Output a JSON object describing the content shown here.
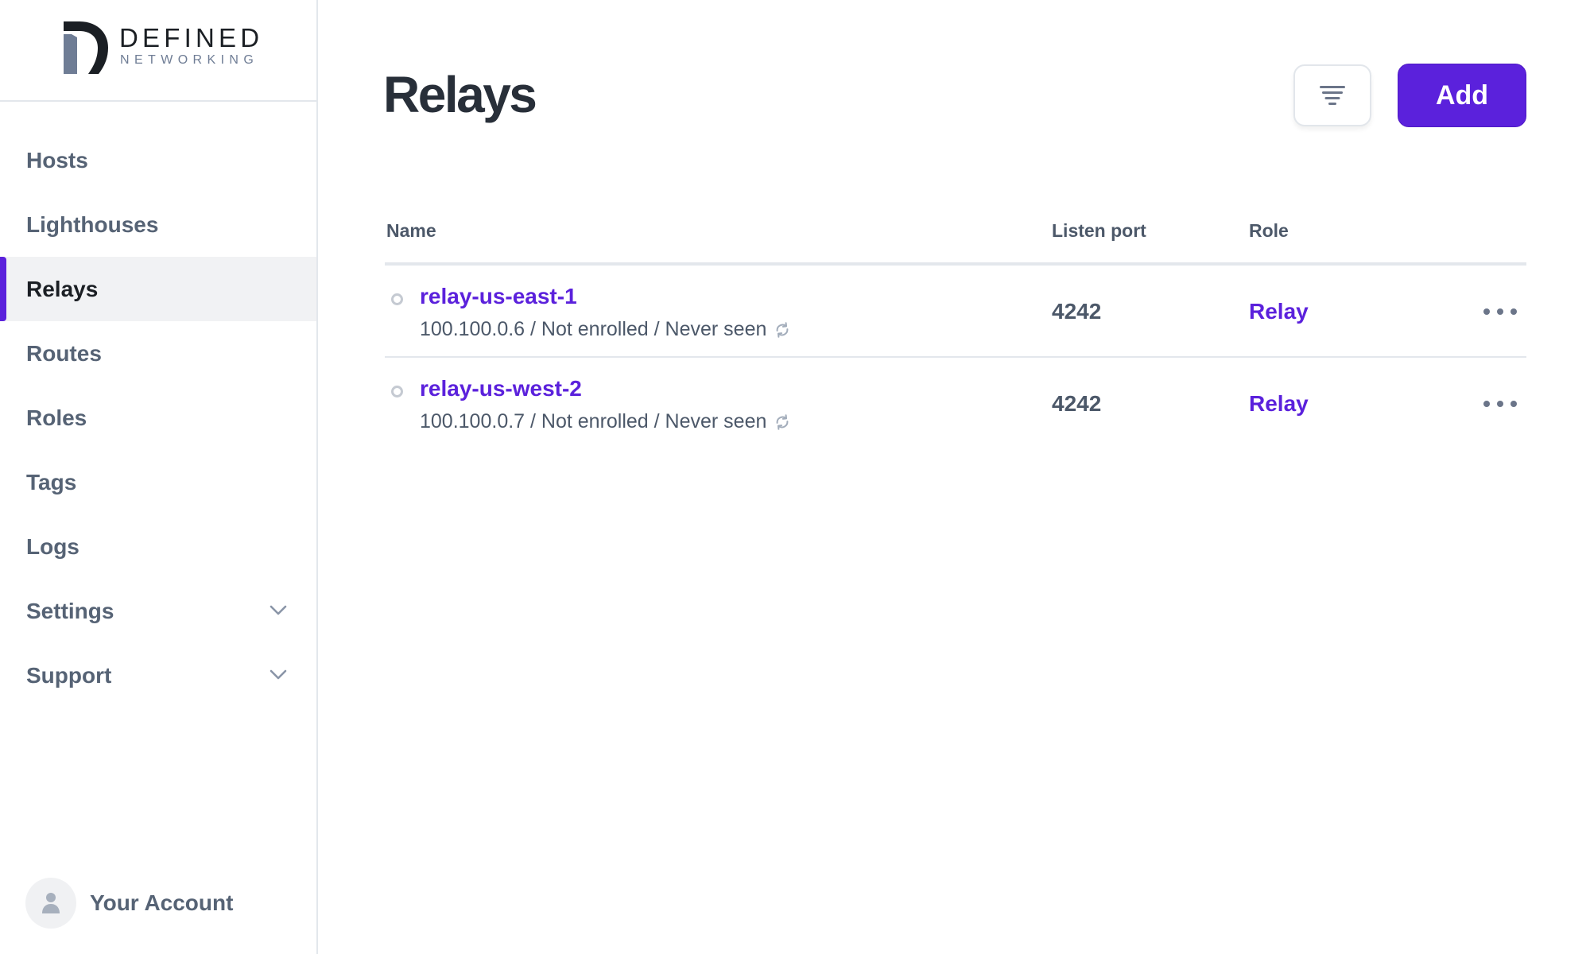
{
  "brand": {
    "name": "DEFINED",
    "tagline": "NETWORKING",
    "logo_icon": "defined-networking-logo",
    "accent_color": "#5b21dc"
  },
  "sidebar": {
    "items": [
      {
        "label": "Hosts",
        "active": false
      },
      {
        "label": "Lighthouses",
        "active": false
      },
      {
        "label": "Relays",
        "active": true
      },
      {
        "label": "Routes",
        "active": false
      },
      {
        "label": "Roles",
        "active": false
      },
      {
        "label": "Tags",
        "active": false
      },
      {
        "label": "Logs",
        "active": false
      },
      {
        "label": "Settings",
        "active": false,
        "expandable": true,
        "icon": "chevron-down-icon"
      },
      {
        "label": "Support",
        "active": false,
        "expandable": true,
        "icon": "chevron-down-icon"
      }
    ],
    "account": {
      "label": "Your Account",
      "icon": "user-icon"
    }
  },
  "header": {
    "title": "Relays",
    "filter_icon": "filter-icon",
    "add_label": "Add"
  },
  "table": {
    "columns": [
      "Name",
      "Listen port",
      "Role"
    ],
    "rows": [
      {
        "name": "relay-us-east-1",
        "ip": "100.100.0.6",
        "enrollment": "Not enrolled",
        "last_seen": "Never seen",
        "meta": "100.100.0.6 / Not enrolled / Never seen",
        "listen_port": "4242",
        "role": "Relay",
        "status": "offline"
      },
      {
        "name": "relay-us-west-2",
        "ip": "100.100.0.7",
        "enrollment": "Not enrolled",
        "last_seen": "Never seen",
        "meta": "100.100.0.7 / Not enrolled / Never seen",
        "listen_port": "4242",
        "role": "Relay",
        "status": "offline"
      }
    ]
  }
}
